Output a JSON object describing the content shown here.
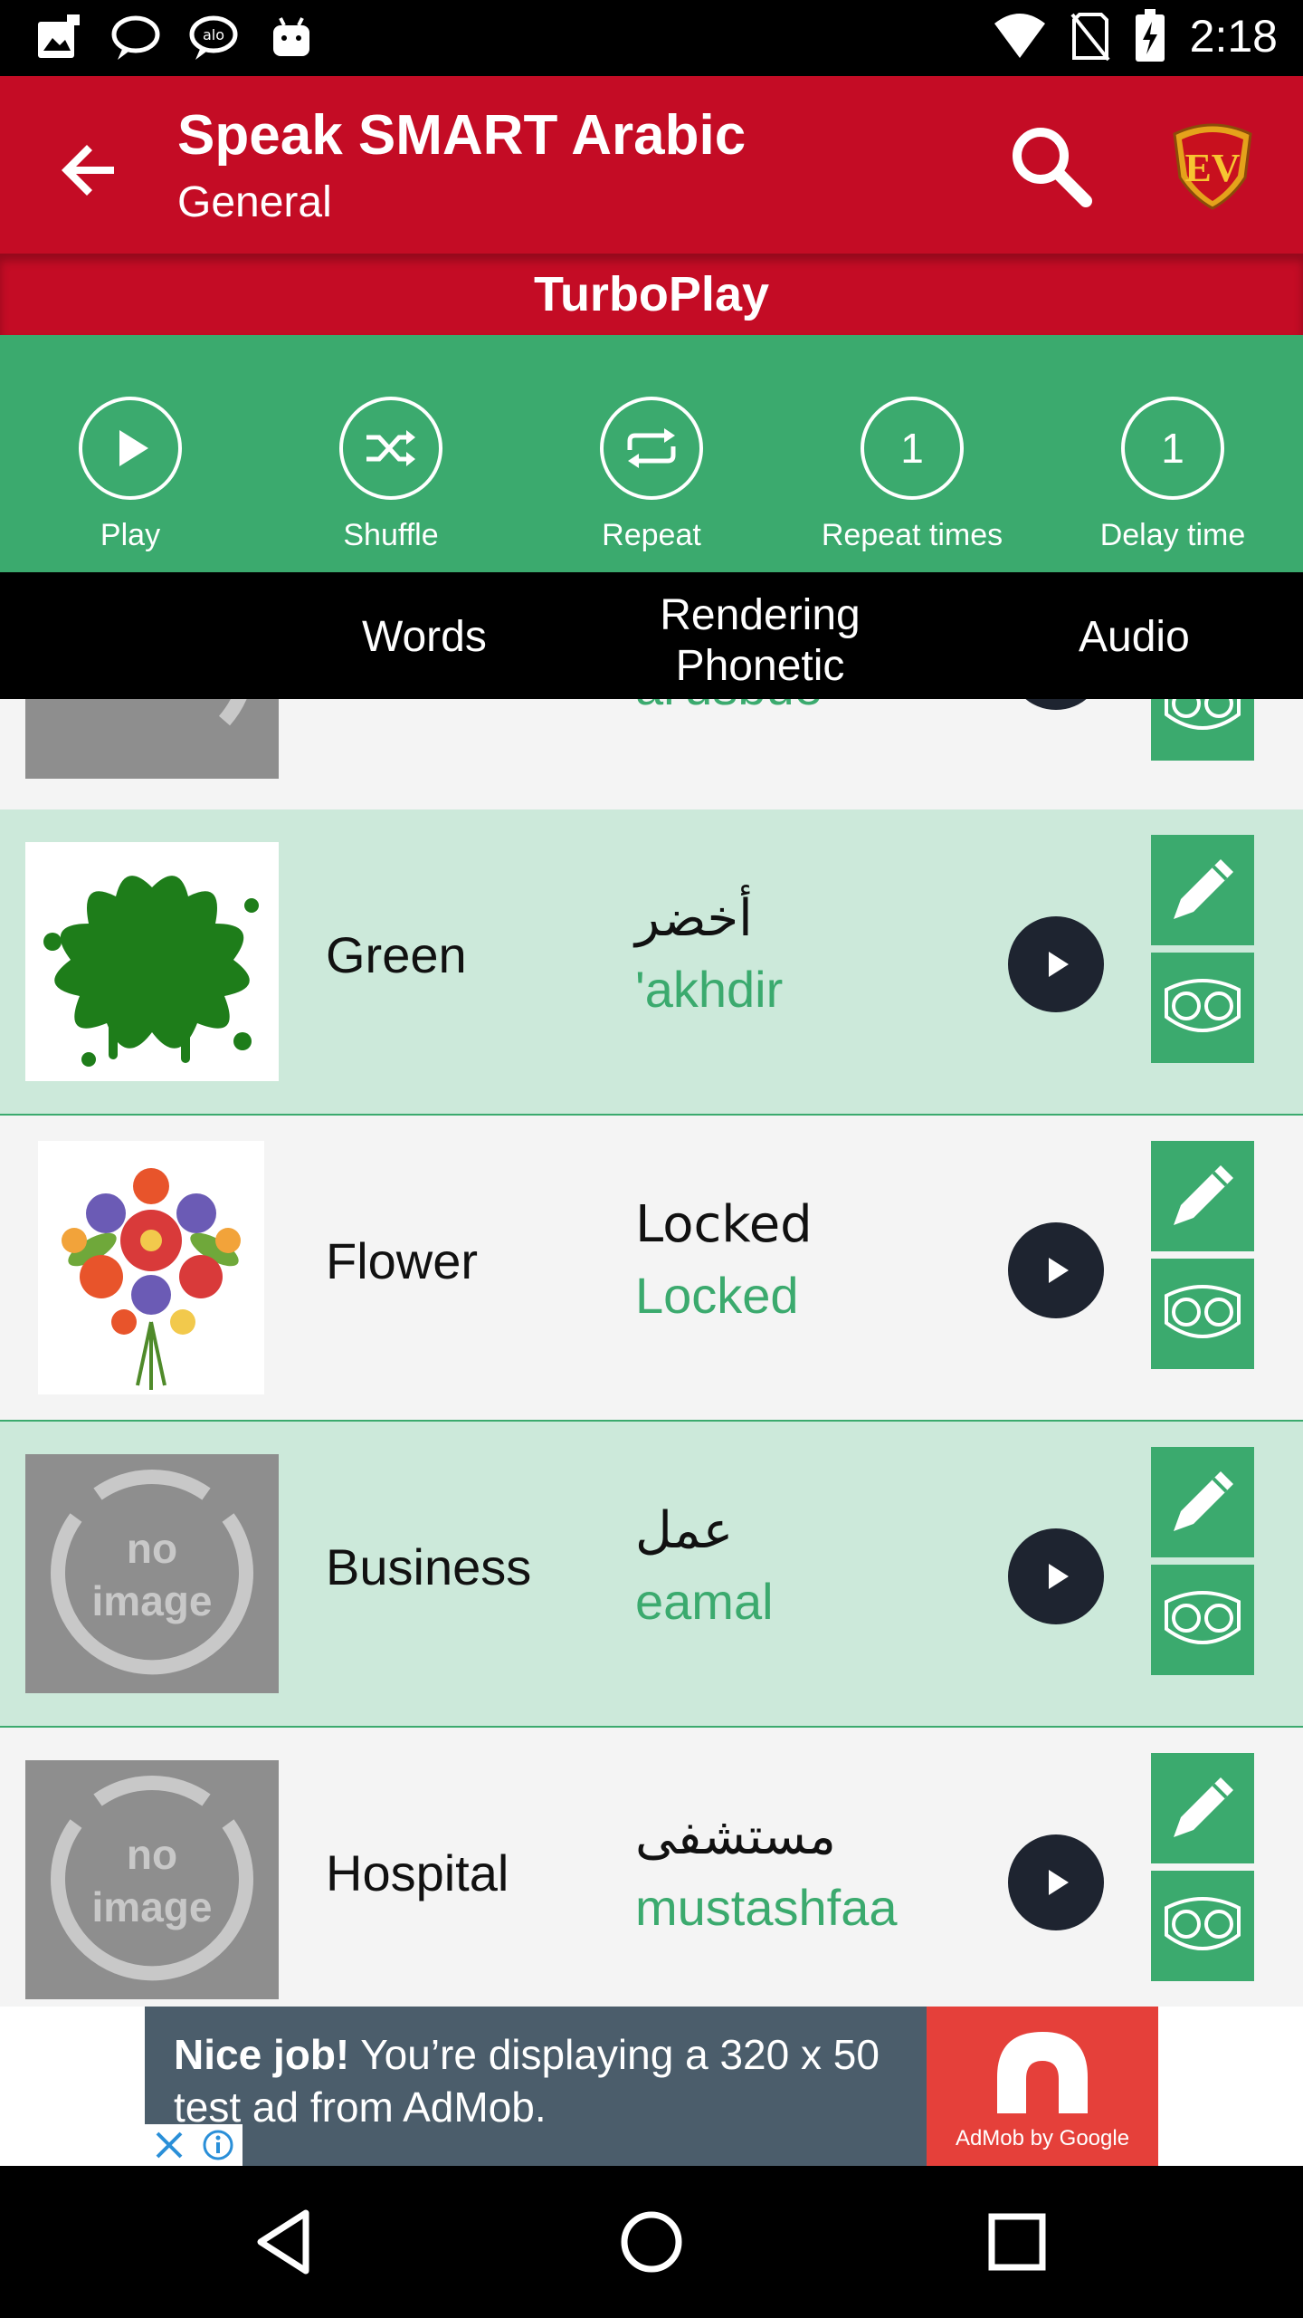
{
  "status_bar": {
    "time": "2:18",
    "left_icons": [
      "photo-notification-icon",
      "chat-bubble-icon",
      "chat-bubble-icon",
      "android-icon"
    ],
    "right_icons": [
      "wifi-icon",
      "no-sim-icon",
      "battery-charging-icon"
    ]
  },
  "app_bar": {
    "title": "Speak SMART Arabic",
    "subtitle": "General",
    "back_icon": "arrow-back-icon",
    "search_icon": "search-icon",
    "logo_text": "EV"
  },
  "turbo": {
    "label": "TurboPlay"
  },
  "controls": [
    {
      "label": "Play",
      "icon": "play-icon",
      "value": ""
    },
    {
      "label": "Shuffle",
      "icon": "shuffle-icon",
      "value": ""
    },
    {
      "label": "Repeat",
      "icon": "repeat-icon",
      "value": ""
    },
    {
      "label": "Repeat times",
      "icon": "",
      "value": "1"
    },
    {
      "label": "Delay time",
      "icon": "",
      "value": "1"
    }
  ],
  "column_headers": {
    "words": "Words",
    "rendering_line1": "Rendering",
    "rendering_line2": "Phonetic",
    "audio": "Audio"
  },
  "rows": [
    {
      "word": "",
      "arabic": "",
      "phonetic": "al'usbue",
      "image": "no-image"
    },
    {
      "word": "Green",
      "arabic": "أخضر",
      "phonetic": "'akhdir",
      "image": "green-splash"
    },
    {
      "word": "Flower",
      "arabic": "Locked",
      "phonetic": "Locked",
      "image": "flower-bouquet"
    },
    {
      "word": "Business",
      "arabic": "عمل",
      "phonetic": "eamal",
      "image": "no-image"
    },
    {
      "word": "Hospital",
      "arabic": "مستشفى",
      "phonetic": "mustashfaa",
      "image": "no-image"
    }
  ],
  "no_image": {
    "line1": "no",
    "line2": "image"
  },
  "ad": {
    "bold": "Nice job!",
    "text": " You’re displaying a 320 x 50 test ad from AdMob.",
    "brand": "AdMob by Google"
  },
  "colors": {
    "red": "#C40C25",
    "green": "#3BAA6E",
    "row_alt": "#CCE9DA",
    "row_plain": "#F4F4F4"
  }
}
